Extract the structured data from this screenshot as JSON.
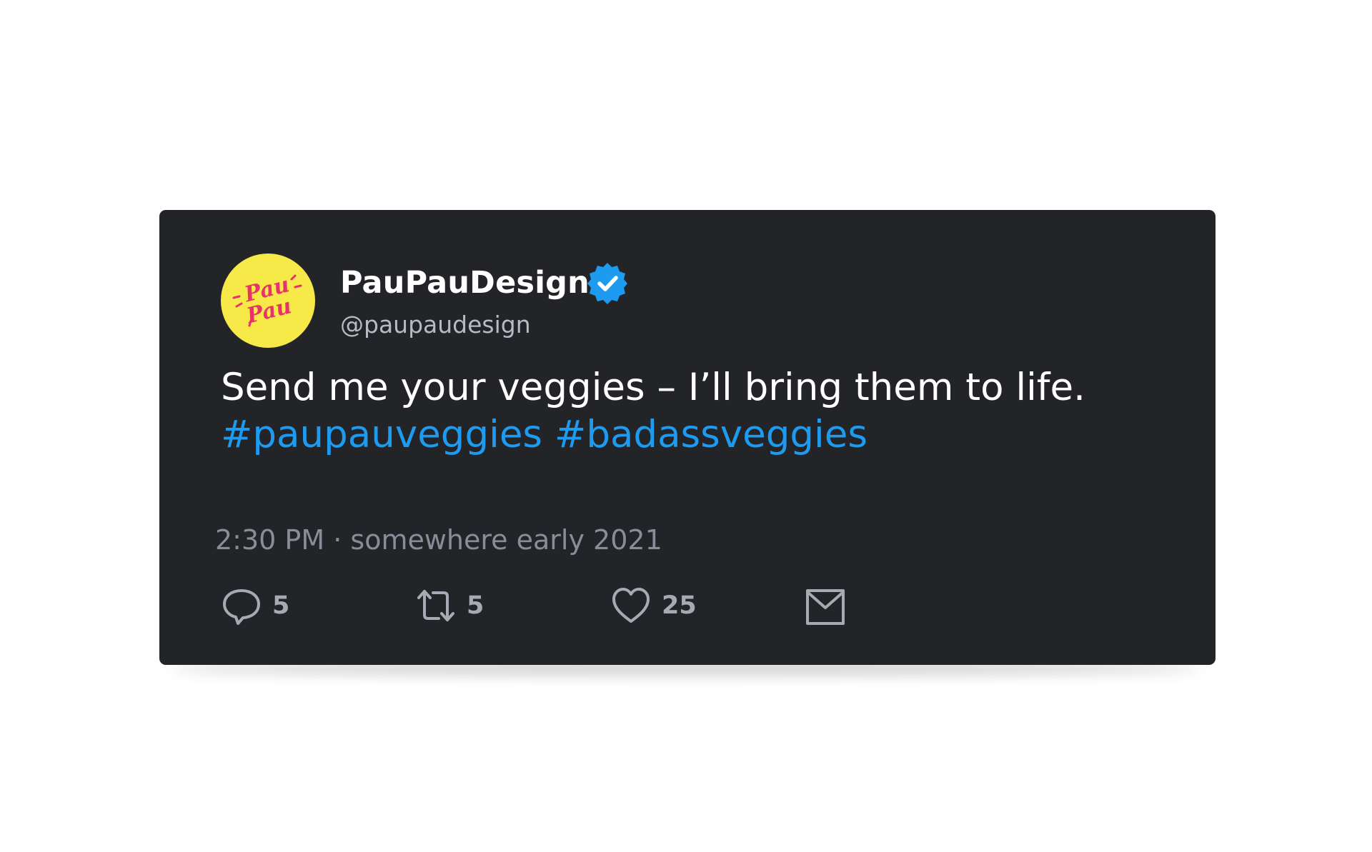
{
  "tweet": {
    "display_name": "PauPauDesign",
    "handle": "@paupaudesign",
    "text": "Send me your veggies – I’ll bring them to life.",
    "hashtags": [
      "#paupauveggies",
      "#badassveggies"
    ],
    "time": "2:30 PM",
    "separator": "·",
    "date": "somewhere early 2021",
    "avatar_text": [
      "Pau",
      "Pau"
    ],
    "verified_icon": "verified-badge-icon"
  },
  "actions": {
    "reply": {
      "icon": "reply-icon",
      "count": "5"
    },
    "retweet": {
      "icon": "retweet-icon",
      "count": "5"
    },
    "like": {
      "icon": "heart-icon",
      "count": "25"
    },
    "share": {
      "icon": "envelope-icon"
    }
  },
  "colors": {
    "card_background": "#232428",
    "hashtag": "#1d9bf0",
    "verified": "#1d9bf0",
    "avatar_background": "#f6e948",
    "avatar_logo": "#e8336a"
  }
}
